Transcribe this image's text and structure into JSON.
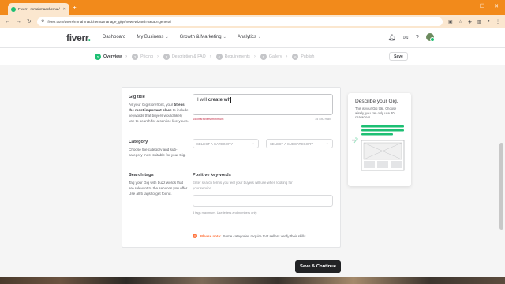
{
  "browser": {
    "tab_title": "Fiverr - mmahmadchemu / Cre",
    "url": "fiverr.com/users/mmahmadchemu/manage_gigs/new?wizard=0&tab=general"
  },
  "nav": {
    "logo": "fiverr",
    "logo_dot": ".",
    "links": [
      {
        "label": "Dashboard"
      },
      {
        "label": "My Business"
      },
      {
        "label": "Growth & Marketing"
      },
      {
        "label": "Analytics"
      }
    ]
  },
  "steps": {
    "items": [
      {
        "num": "1",
        "label": "Overview"
      },
      {
        "num": "2",
        "label": "Pricing"
      },
      {
        "num": "3",
        "label": "Description & FAQ"
      },
      {
        "num": "4",
        "label": "Requirements"
      },
      {
        "num": "5",
        "label": "Gallery"
      },
      {
        "num": "6",
        "label": "Publish"
      }
    ],
    "save_label": "Save"
  },
  "gig_title": {
    "heading": "Gig title",
    "desc_1": "As your Gig storefront, your ",
    "desc_bold": "title is the most important place",
    "desc_2": " to include keywords that buyers would likely use to search for a service like yours.",
    "value_prefix": "I will ",
    "value_typed": "create wh",
    "min_message": "15 characters minimum",
    "char_count": "15 / 80 max"
  },
  "category": {
    "heading": "Category",
    "desc": "Choose the category and sub-category most suitable for your Gig.",
    "category_placeholder": "SELECT A CATEGORY",
    "subcategory_placeholder": "SELECT A SUBCATEGORY"
  },
  "search_tags": {
    "heading": "Search tags",
    "desc": "Tag your Gig with buzz words that are relevant to the services you offer. Use all 5 tags to get found.",
    "field_label": "Positive keywords",
    "field_hint": "Enter search terms you feel your buyers will use when looking for your service.",
    "tags_hint": "5 tags maximum. Use letters and numbers only."
  },
  "note": {
    "label": "Please note:",
    "text": " Some categories require that sellers verify their skills."
  },
  "help": {
    "title": "Describe your Gig.",
    "desc": "This is your Gig title. Choose wisely, you can only use 80 characters.",
    "caption": "title"
  },
  "continue_label": "Save & Continue",
  "colors": {
    "brand_green": "#1dbf73",
    "browser_orange": "#f28a1b",
    "warning_red": "#c4314b",
    "note_orange": "#ff7640"
  }
}
